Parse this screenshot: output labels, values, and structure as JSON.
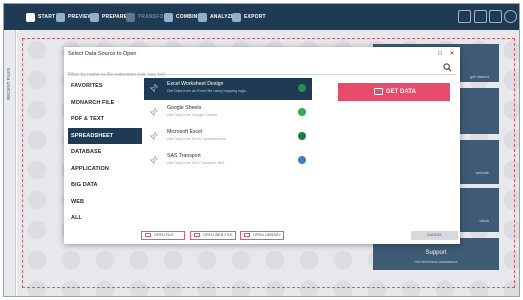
{
  "toolbar": {
    "start": "START",
    "preview": "PREVIEW",
    "prepare": "PREPARE*",
    "transform": "TRANSFORM",
    "combine": "COMBINE",
    "analyze": "ANALYZE",
    "export": "EXPORT"
  },
  "rail": {
    "label": "RECENT FILES"
  },
  "dialog": {
    "title": "Select Data Source to Open",
    "search_placeholder": "Filter by name or file extension (xls, csv, txt)",
    "categories": [
      "FAVORITES",
      "MONARCH FILE",
      "PDF & TEXT",
      "SPREADSHEET",
      "DATABASE",
      "APPLICATION",
      "BIG DATA",
      "WEB",
      "ALL"
    ],
    "active_category": "SPREADSHEET",
    "items": [
      {
        "name": "Excel Worksheet Design",
        "desc": "Get Data from an Excel file using trapping logic",
        "icon_color": "#2e8b57"
      },
      {
        "name": "Google Sheets",
        "desc": "Get Data from Google Sheets",
        "icon_color": "#34a853"
      },
      {
        "name": "Microsoft Excel",
        "desc": "Get Data from Excel Spreadsheets",
        "icon_color": "#1d7a3f"
      },
      {
        "name": "SAS Transport",
        "desc": "Get Data from SAS Transport files",
        "icon_color": "#3b7fc4"
      }
    ],
    "get_data": "GET DATA",
    "open_file": "OPEN FILE",
    "open_web_file": "OPEN WEB FILE",
    "open_library": "OPEN LIBRARY",
    "cancel": "CANCEL"
  },
  "background": {
    "card1_text": "get started",
    "card3_text": "website",
    "card4_text": "ideas",
    "support_title": "Support",
    "support_sub": "Get technical assistance"
  },
  "colors": {
    "navy": "#1e3b53",
    "accent": "#e84c6b"
  }
}
